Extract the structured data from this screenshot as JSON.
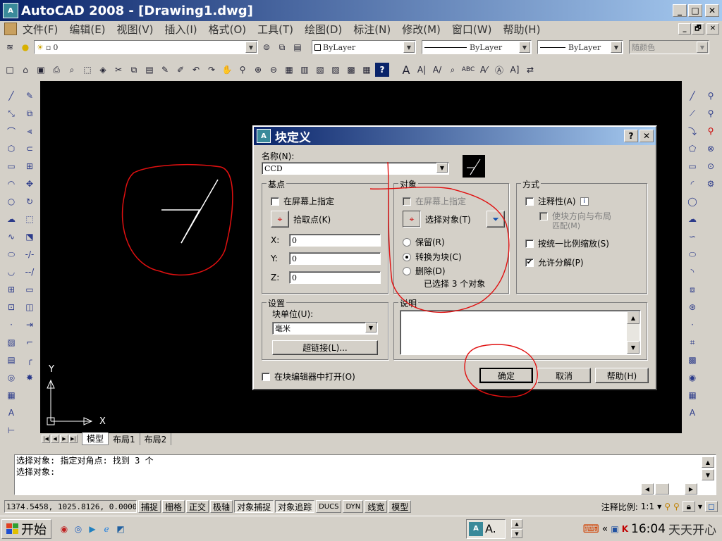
{
  "app": {
    "title": "AutoCAD 2008 - [Drawing1.dwg]",
    "window_controls": [
      "_",
      "□",
      "✕"
    ],
    "doc_controls": [
      "_",
      "🗗",
      "✕"
    ]
  },
  "menu": [
    "文件(F)",
    "编辑(E)",
    "视图(V)",
    "插入(I)",
    "格式(O)",
    "工具(T)",
    "绘图(D)",
    "标注(N)",
    "修改(M)",
    "窗口(W)",
    "帮助(H)"
  ],
  "layers_toolbar": {
    "layer_value": "0",
    "color_value": "ByLayer",
    "linetype_value": "ByLayer",
    "lineweight_value": "ByLayer",
    "plotstyle_value": "随颜色"
  },
  "layout_tabs": [
    "模型",
    "布局1",
    "布局2"
  ],
  "ucs": {
    "x_label": "X",
    "y_label": "Y"
  },
  "dialog": {
    "title": "块定义",
    "help_btn": "?",
    "close_btn": "✕",
    "name_label": "名称(N):",
    "name_value": "CCD",
    "base_point": {
      "label": "基点",
      "specify_on_screen": "在屏幕上指定",
      "pick_point": "拾取点(K)",
      "x_label": "X:",
      "x_value": "0",
      "y_label": "Y:",
      "y_value": "0",
      "z_label": "Z:",
      "z_value": "0"
    },
    "objects": {
      "label": "对象",
      "specify_on_screen": "在屏幕上指定",
      "select_objects": "选择对象(T)",
      "retain": "保留(R)",
      "convert": "转换为块(C)",
      "delete": "删除(D)",
      "selected_count": "已选择 3 个对象",
      "selected_option": "convert"
    },
    "behavior": {
      "label": "方式",
      "annotative": "注释性(A)",
      "match_orientation_1": "使块方向与布局",
      "match_orientation_2": "匹配(M)",
      "scale_uniformly": "按统一比例缩放(S)",
      "allow_exploding": "允许分解(P)",
      "allow_exploding_checked": true
    },
    "settings": {
      "label": "设置",
      "block_unit_label": "块单位(U):",
      "block_unit_value": "毫米",
      "hyperlink": "超链接(L)..."
    },
    "description": {
      "label": "说明"
    },
    "open_in_editor": "在块编辑器中打开(O)",
    "ok": "确定",
    "cancel": "取消",
    "help": "帮助(H)"
  },
  "command": {
    "line1": "选择对象: 指定对角点: 找到 3 个",
    "line2": "选择对象:"
  },
  "status": {
    "coords": "1374.5458, 1025.8126, 0.0000",
    "toggles": [
      "捕捉",
      "栅格",
      "正交",
      "极轴",
      "对象捕捉",
      "对象追踪",
      "DUCS",
      "DYN",
      "线宽",
      "模型"
    ],
    "toggles_on": [
      "对象捕捉",
      "对象追踪"
    ],
    "annotation_scale_label": "注释比例:",
    "annotation_scale_value": "1:1"
  },
  "taskbar": {
    "start": "开始",
    "task_button": "A.",
    "time": "16:04",
    "tray_text": "天天开心"
  },
  "colors": {
    "titlebar_start": "#0a246a",
    "titlebar_end": "#a6caf0",
    "canvas": "#000000",
    "annotation_red": "#e01010"
  }
}
